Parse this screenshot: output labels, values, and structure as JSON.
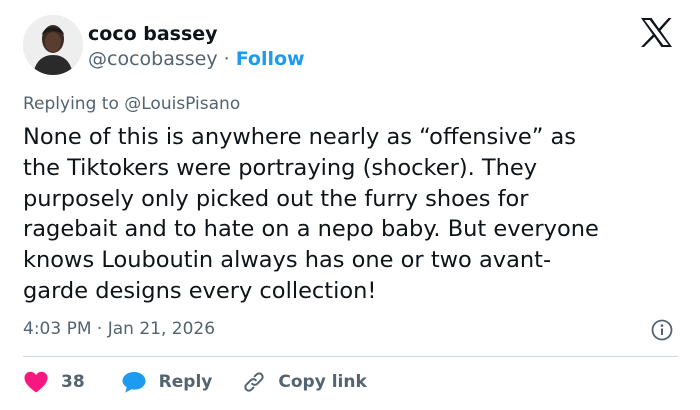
{
  "author": {
    "display_name": "coco bassey",
    "handle": "@cocobassey",
    "separator": "·",
    "follow_label": "Follow"
  },
  "reply_context": {
    "prefix": "Replying to",
    "mention": "@LouisPisano"
  },
  "tweet": {
    "lines": [
      "None of this is anywhere nearly as “offensive” as",
      "the Tiktokers were portraying (shocker). They",
      "purposely only picked out the furry shoes for",
      "ragebait and to hate on a nepo baby. But everyone",
      "knows Louboutin always has one or two avant-",
      "garde designs every collection!"
    ]
  },
  "meta": {
    "timestamp": "4:03 PM · Jan 21, 2026"
  },
  "actions": {
    "like_count": "38",
    "reply_label": "Reply",
    "copy_link_label": "Copy link"
  },
  "icons": {
    "logo": "x-logo",
    "info": "info-icon",
    "like": "heart-icon",
    "reply": "speech-bubble-icon",
    "copy": "link-icon"
  },
  "colors": {
    "text": "#0f1419",
    "secondary": "#536471",
    "accent": "#1d9bf0",
    "like": "#f91880",
    "divider": "#cfd9de"
  }
}
